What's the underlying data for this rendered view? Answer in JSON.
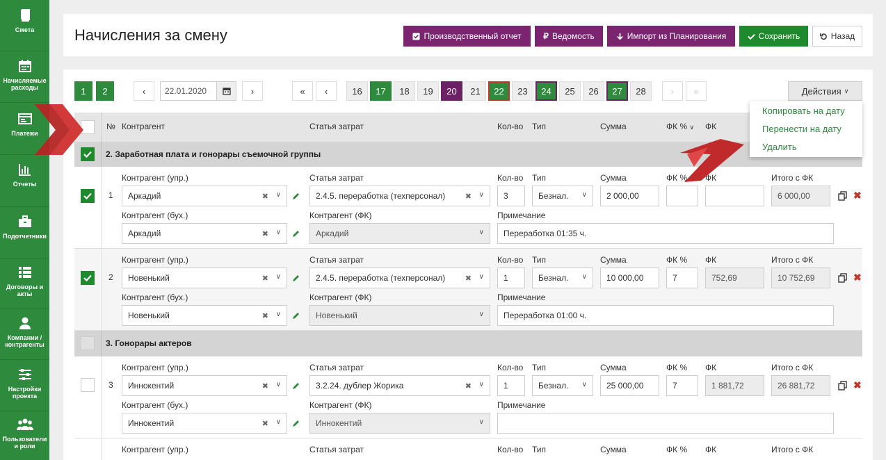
{
  "sidebar": {
    "items": [
      {
        "label": "Смета",
        "icon": "book-icon"
      },
      {
        "label": "Начисляемые расходы",
        "icon": "calendar-icon"
      },
      {
        "label": "Платежи",
        "icon": "payments-icon"
      },
      {
        "label": "Отчеты",
        "icon": "bar-chart-icon"
      },
      {
        "label": "Подотчетники",
        "icon": "briefcase-icon"
      },
      {
        "label": "Договоры и акты",
        "icon": "list-icon"
      },
      {
        "label": "Компании / контрагенты",
        "icon": "user-icon"
      },
      {
        "label": "Настройки проекта",
        "icon": "sliders-icon"
      },
      {
        "label": "Пользователи и роли",
        "icon": "users-icon"
      }
    ]
  },
  "header": {
    "title": "Начисления за смену",
    "buttons": {
      "report": "Производственный отчет",
      "ledger": "Ведомость",
      "import": "Импорт из Планирования",
      "save": "Сохранить",
      "back": "Назад"
    }
  },
  "toolbar": {
    "pages": [
      "1",
      "2"
    ],
    "date": "22.01.2020",
    "days": [
      "16",
      "17",
      "18",
      "19",
      "20",
      "21",
      "22",
      "23",
      "24",
      "25",
      "26",
      "27",
      "28"
    ],
    "actions_label": "Действия",
    "nav": {
      "first": "«",
      "prev": "‹",
      "next": "›",
      "last": "»"
    }
  },
  "table": {
    "headers": {
      "num": "№",
      "contractor": "Контрагент",
      "article": "Статья затрат",
      "qty": "Кол-во",
      "type": "Тип",
      "sum": "Сумма",
      "fk_pct": "ФК %",
      "fk": "ФК"
    },
    "labels": {
      "contractor_upr": "Контрагент (упр.)",
      "contractor_buh": "Контрагент (бух.)",
      "article": "Статья затрат",
      "contractor_fk": "Контрагент (ФК)",
      "qty": "Кол-во",
      "type": "Тип",
      "sum": "Сумма",
      "fk_pct": "ФК %",
      "fk": "ФК",
      "total": "Итого с ФК",
      "note": "Примечание"
    },
    "groups": [
      {
        "title": "2. Заработная плата и гонорары съемочной группы",
        "checked": true
      },
      {
        "title": "3. Гонорары актеров",
        "checked": false
      }
    ],
    "rows": [
      {
        "num": "1",
        "checked": true,
        "upr": "Аркадий",
        "buh": "Аркадий",
        "article": "2.4.5. переработка (техперсонал)",
        "fk_contractor": "Аркадий",
        "qty": "3",
        "type": "Безнал.",
        "sum": "2 000,00",
        "fk_pct": "",
        "fk": "",
        "total": "6 000,00",
        "note": "Переработка 01:35 ч."
      },
      {
        "num": "2",
        "checked": true,
        "upr": "Новенький",
        "buh": "Новенький",
        "article": "2.4.5. переработка (техперсонал)",
        "fk_contractor": "Новенький",
        "qty": "1",
        "type": "Безнал.",
        "sum": "10 000,00",
        "fk_pct": "7",
        "fk": "752,69",
        "total": "10 752,69",
        "note": "Переработка 01:00 ч."
      },
      {
        "num": "3",
        "checked": false,
        "upr": "Иннокентий",
        "buh": "Иннокентий",
        "article": "3.2.24. дублер Жорика",
        "fk_contractor": "Иннокентий",
        "qty": "1",
        "type": "Безнал.",
        "sum": "25 000,00",
        "fk_pct": "7",
        "fk": "1 881,72",
        "total": "26 881,72",
        "note": ""
      }
    ]
  },
  "dropdown": {
    "items": [
      "Копировать на дату",
      "Перенести на дату",
      "Удалить"
    ]
  },
  "colors": {
    "green": "#2e8b3e",
    "purple": "#7b2470",
    "red": "#c0392b"
  }
}
